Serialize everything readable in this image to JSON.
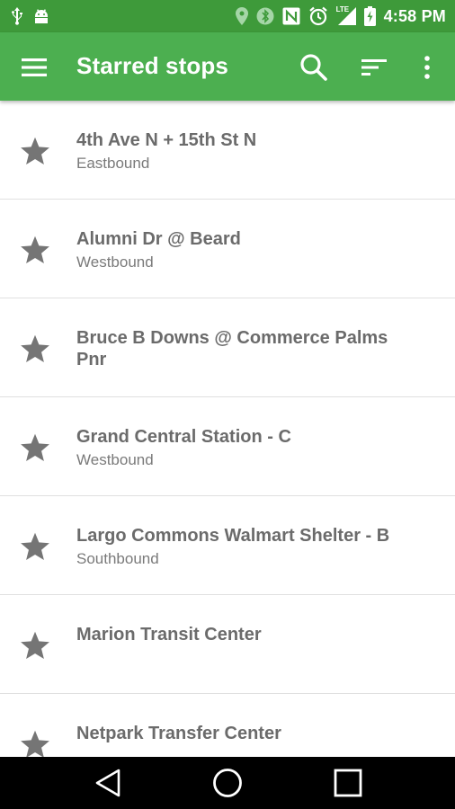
{
  "status_bar": {
    "time": "4:58 PM",
    "lte_label": "LTE",
    "icons": [
      "usb-icon",
      "android-debug-icon",
      "location-icon",
      "bluetooth-icon",
      "nfc-icon",
      "alarm-icon",
      "signal-icon",
      "battery-charging-icon"
    ]
  },
  "app_bar": {
    "title": "Starred stops",
    "background": "#4caf50",
    "icons": [
      "menu-icon",
      "search-icon",
      "sort-icon",
      "more-vert-icon"
    ]
  },
  "stops": [
    {
      "name": "4th Ave N + 15th St N",
      "direction": "Eastbound"
    },
    {
      "name": "Alumni Dr @ Beard",
      "direction": "Westbound"
    },
    {
      "name": "Bruce B Downs @ Commerce Palms Pnr",
      "direction": ""
    },
    {
      "name": "Grand Central Station - C",
      "direction": "Westbound"
    },
    {
      "name": "Largo Commons Walmart Shelter - B",
      "direction": "Southbound"
    },
    {
      "name": "Marion Transit Center",
      "direction": ""
    },
    {
      "name": "Netpark Transfer Center",
      "direction": ""
    }
  ],
  "nav_bar": {
    "icons": [
      "back-icon",
      "home-icon",
      "recents-icon"
    ]
  }
}
